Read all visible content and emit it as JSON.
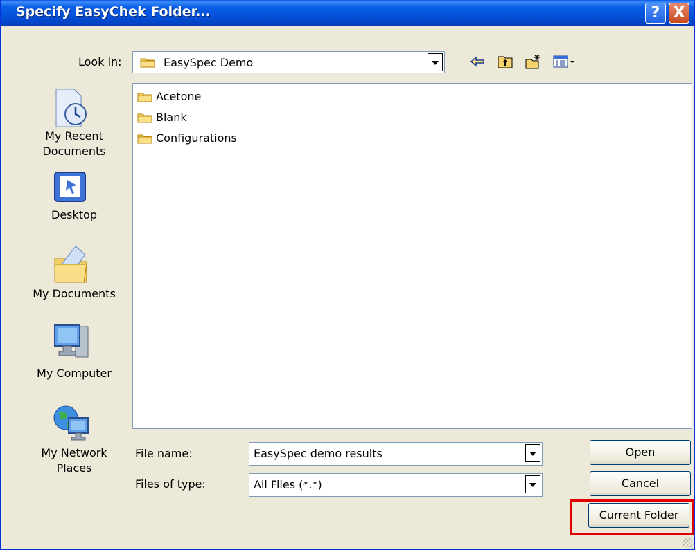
{
  "window": {
    "title": "Specify EasyChek Folder..."
  },
  "titlebar_buttons": {
    "help": "?",
    "close": "X"
  },
  "look_in": {
    "label": "Look in:",
    "value": "EasySpec Demo"
  },
  "toolbar_icons": [
    "back-arrow-icon",
    "up-folder-icon",
    "new-folder-icon",
    "view-menu-icon"
  ],
  "places": [
    {
      "label_line1": "My Recent",
      "label_line2": "Documents",
      "icon": "recent-documents-icon"
    },
    {
      "label_line1": "Desktop",
      "label_line2": "",
      "icon": "desktop-icon"
    },
    {
      "label_line1": "My Documents",
      "label_line2": "",
      "icon": "my-documents-icon"
    },
    {
      "label_line1": "My Computer",
      "label_line2": "",
      "icon": "my-computer-icon"
    },
    {
      "label_line1": "My Network",
      "label_line2": "Places",
      "icon": "network-places-icon"
    }
  ],
  "files": [
    {
      "name": "Acetone",
      "icon": "folder-icon"
    },
    {
      "name": "Blank",
      "icon": "folder-icon"
    },
    {
      "name": "Configurations",
      "icon": "folder-icon"
    }
  ],
  "file_name": {
    "label": "File name:",
    "value": "EasySpec demo results"
  },
  "file_type": {
    "label": "Files of type:",
    "value": "All Files (*.*)"
  },
  "buttons": {
    "open": "Open",
    "cancel": "Cancel",
    "current_folder": "Current Folder"
  },
  "colors": {
    "titlebar": "#0552D8",
    "dialog_bg": "#ECE9D8",
    "highlight": "#E00000",
    "folder": "#F5D26B"
  }
}
